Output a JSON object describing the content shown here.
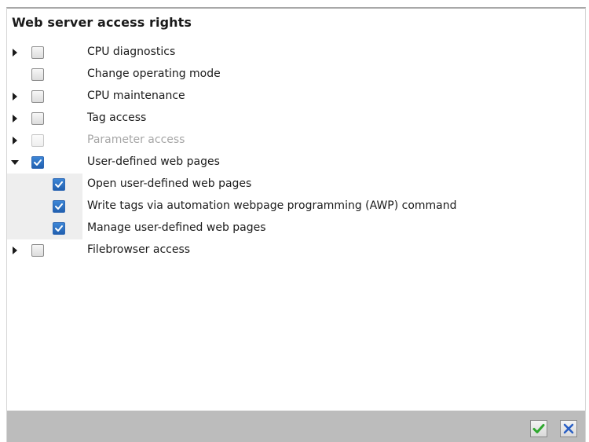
{
  "panel": {
    "title": "Web server access rights"
  },
  "items": [
    {
      "label": "CPU diagnostics",
      "expander": "collapsed",
      "checked": false,
      "disabled": false
    },
    {
      "label": "Change operating mode",
      "expander": "none",
      "checked": false,
      "disabled": false
    },
    {
      "label": "CPU maintenance",
      "expander": "collapsed",
      "checked": false,
      "disabled": false
    },
    {
      "label": "Tag access",
      "expander": "collapsed",
      "checked": false,
      "disabled": false
    },
    {
      "label": "Parameter access",
      "expander": "collapsed",
      "checked": false,
      "disabled": true
    },
    {
      "label": "User-defined web pages",
      "expander": "expanded",
      "checked": true,
      "disabled": false
    },
    {
      "label": "Open user-defined web pages",
      "expander": "none",
      "checked": true,
      "disabled": false,
      "child": true
    },
    {
      "label": "Write tags via automation webpage programming (AWP) command",
      "expander": "none",
      "checked": true,
      "disabled": false,
      "child": true
    },
    {
      "label": "Manage user-defined web pages",
      "expander": "none",
      "checked": true,
      "disabled": false,
      "child": true
    },
    {
      "label": "Filebrowser access",
      "expander": "collapsed",
      "checked": false,
      "disabled": false
    }
  ],
  "footer": {
    "confirm_icon": "checkmark-icon",
    "cancel_icon": "close-icon",
    "colors": {
      "confirm": "#2fa82f",
      "cancel": "#2a5fc4",
      "checked_box": "#2a6fc4"
    }
  }
}
